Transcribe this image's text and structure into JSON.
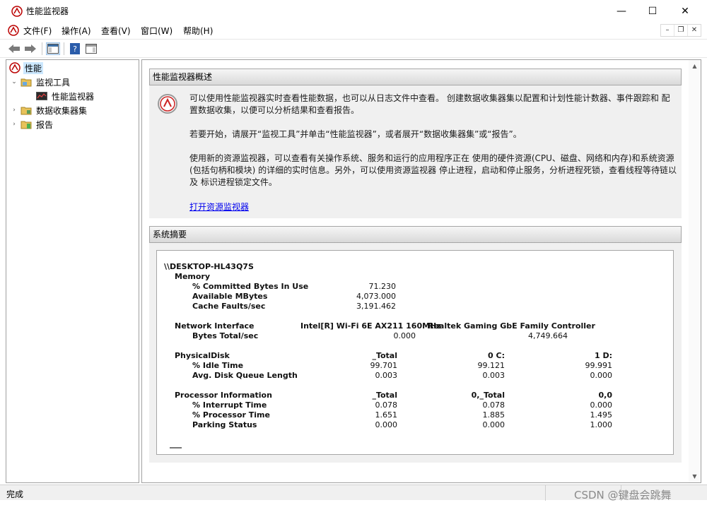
{
  "window": {
    "title": "性能监视器",
    "min_glyph": "—",
    "max_glyph": "☐",
    "close_glyph": "✕"
  },
  "menu": [
    "文件(F)",
    "操作(A)",
    "查看(V)",
    "窗口(W)",
    "帮助(H)"
  ],
  "mdi": {
    "min": "–",
    "restore": "❐",
    "close": "✕"
  },
  "tree": {
    "root": "性能",
    "items": [
      {
        "label": "监视工具",
        "expander": "⌄"
      },
      {
        "label": "性能监视器"
      },
      {
        "label": "数据收集器集",
        "expander": "›"
      },
      {
        "label": "报告",
        "expander": "›"
      }
    ]
  },
  "overview": {
    "header": "性能监视器概述",
    "p1": "可以使用性能监视器实时查看性能数据，也可以从日志文件中查看。 创建数据收集器集以配置和计划性能计数器、事件跟踪和 配置数据收集，以便可以分析结果和查看报告。",
    "p2": "若要开始，请展开“监视工具”并单击“性能监视器”，或者展开“数据收集器集”或“报告”。",
    "p3": "使用新的资源监视器，可以查看有关操作系统、服务和运行的应用程序正在 使用的硬件资源(CPU、磁盘、网络和内存)和系统资源(包括句柄和模块) 的详细的实时信息。另外，可以使用资源监视器 停止进程，启动和停止服务，分析进程死锁，查看线程等待链以及 标识进程锁定文件。",
    "link": "打开资源监视器"
  },
  "summary": {
    "header": "系统摘要",
    "host": "\\\\DESKTOP-HL43Q7S",
    "memory": {
      "label": "Memory",
      "rows": [
        {
          "name": "% Committed Bytes In Use",
          "value": "71.230"
        },
        {
          "name": "Available MBytes",
          "value": "4,073.000"
        },
        {
          "name": "Cache Faults/sec",
          "value": "3,191.462"
        }
      ]
    },
    "network": {
      "label": "Network Interface",
      "col1": "Intel[R] Wi-Fi 6E AX211 160MHz",
      "col2": "Realtek Gaming GbE Family Controller",
      "row": {
        "name": "Bytes Total/sec",
        "v1": "0.000",
        "v2": "4,749.664"
      }
    },
    "disk": {
      "label": "PhysicalDisk",
      "cols": [
        "_Total",
        "0 C:",
        "1 D:"
      ],
      "rows": [
        {
          "name": "% Idle Time",
          "v": [
            "99.701",
            "99.121",
            "99.991"
          ]
        },
        {
          "name": "Avg. Disk Queue Length",
          "v": [
            "0.003",
            "0.003",
            "0.000"
          ]
        }
      ]
    },
    "processor": {
      "label": "Processor Information",
      "cols": [
        "_Total",
        "0,_Total",
        "0,0"
      ],
      "rows": [
        {
          "name": "% Interrupt Time",
          "v": [
            "0.078",
            "0.078",
            "0.000"
          ]
        },
        {
          "name": "% Processor Time",
          "v": [
            "1.651",
            "1.885",
            "1.495"
          ]
        },
        {
          "name": "Parking Status",
          "v": [
            "0.000",
            "0.000",
            "1.000"
          ]
        }
      ]
    }
  },
  "status": {
    "text": "完成",
    "watermark": "CSDN @键盘会跳舞"
  },
  "colors": {
    "selected": "#cce8ff",
    "link": "#0000ee",
    "panel": "#f0f0f0"
  }
}
